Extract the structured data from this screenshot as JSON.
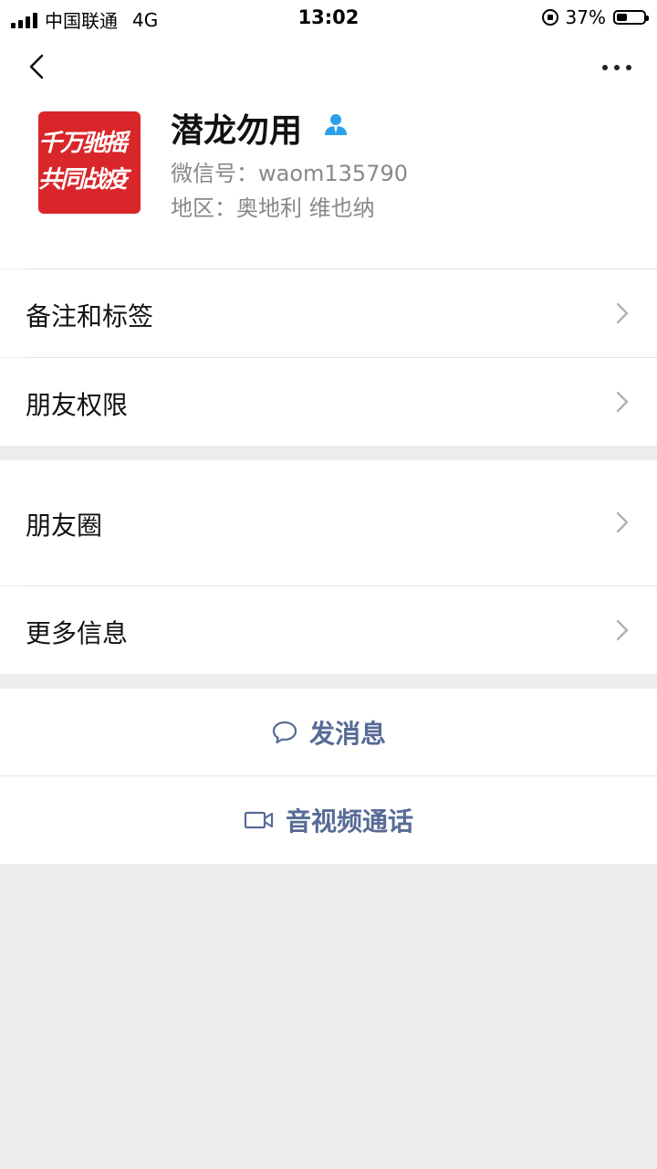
{
  "status_bar": {
    "carrier": "中国联通",
    "network": "4G",
    "time": "13:02",
    "battery": "37%"
  },
  "profile": {
    "name": "潜龙勿用",
    "wechat_id": "微信号：waom135790",
    "region": "地区：奥地利 维也纳",
    "avatar_line1": "千万驰摇",
    "avatar_line2": "共同战疫"
  },
  "menu": {
    "remarks_tags": "备注和标签",
    "friend_permissions": "朋友权限",
    "moments": "朋友圈",
    "more_info": "更多信息"
  },
  "actions": {
    "send_message": "发消息",
    "video_call": "音视频通话"
  },
  "colors": {
    "link": "#576b95",
    "background": "#ededed",
    "verified_icon": "#2aa0ea",
    "avatar_bg": "#d9262a"
  }
}
